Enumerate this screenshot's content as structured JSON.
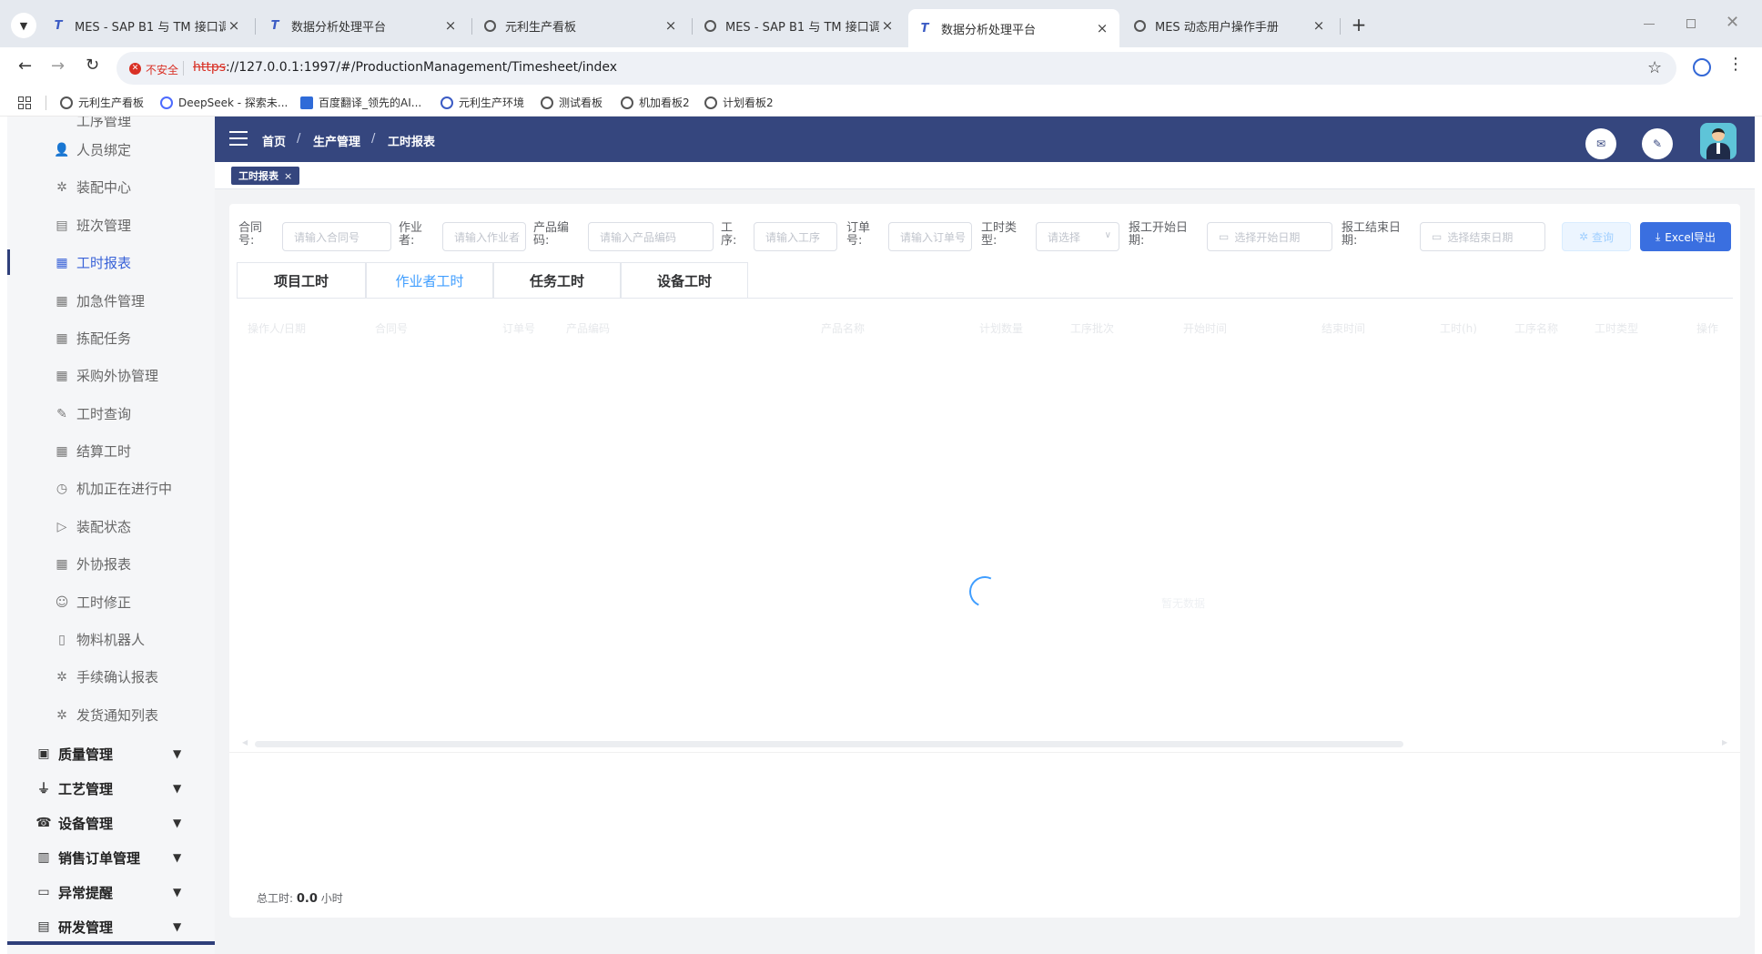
{
  "browser": {
    "tabs": [
      {
        "title": "MES - SAP B1 与 TM 接口调用",
        "icon": "tm-logo-icon",
        "active": false
      },
      {
        "title": "数据分析处理平台",
        "icon": "tm-logo-icon",
        "active": false
      },
      {
        "title": "元利生产看板",
        "icon": "globe-icon",
        "active": false
      },
      {
        "title": "MES - SAP B1 与 TM 接口调用",
        "icon": "globe-icon",
        "active": false
      },
      {
        "title": "数据分析处理平台",
        "icon": "tm-logo-icon",
        "active": true
      },
      {
        "title": "MES 动态用户操作手册",
        "icon": "globe-icon",
        "active": false
      }
    ],
    "close_glyph": "×",
    "new_tab_glyph": "+",
    "security_label": "不安全",
    "url_scheme": "https",
    "url_rest": "://127.0.0.1:1997/#/ProductionManagement/Timesheet/index",
    "bookmarks": [
      "元利生产看板",
      "DeepSeek - 探索未...",
      "百度翻译_领先的AI...",
      "元利生产环境",
      "测试看板",
      "机加看板2",
      "计划看板2"
    ]
  },
  "sidebar": {
    "partial_top_label": "工序管理",
    "items": [
      {
        "label": "人员绑定",
        "icon": "user-link-icon"
      },
      {
        "label": "装配中心",
        "icon": "gear-icon"
      },
      {
        "label": "班次管理",
        "icon": "calendar-icon"
      },
      {
        "label": "工时报表",
        "icon": "report-icon",
        "active": true
      },
      {
        "label": "加急件管理",
        "icon": "report-icon"
      },
      {
        "label": "拣配任务",
        "icon": "report-icon"
      },
      {
        "label": "采购外协管理",
        "icon": "report-icon"
      },
      {
        "label": "工时查询",
        "icon": "edit-icon"
      },
      {
        "label": "结算工时",
        "icon": "report-icon"
      },
      {
        "label": "机加正在进行中",
        "icon": "clock-icon"
      },
      {
        "label": "装配状态",
        "icon": "play-icon"
      },
      {
        "label": "外协报表",
        "icon": "report-icon"
      },
      {
        "label": "工时修正",
        "icon": "user-edit-icon"
      },
      {
        "label": "物料机器人",
        "icon": "document-icon"
      },
      {
        "label": "手续确认报表",
        "icon": "gear-icon"
      },
      {
        "label": "发货通知列表",
        "icon": "gear-icon"
      }
    ],
    "groups": [
      {
        "label": "质量管理",
        "icon": "quality-icon"
      },
      {
        "label": "工艺管理",
        "icon": "process-icon"
      },
      {
        "label": "设备管理",
        "icon": "device-icon"
      },
      {
        "label": "销售订单管理",
        "icon": "order-icon"
      },
      {
        "label": "异常提醒",
        "icon": "monitor-icon"
      },
      {
        "label": "研发管理",
        "icon": "rd-icon"
      }
    ],
    "caret_glyph": "▼"
  },
  "header": {
    "breadcrumb": [
      "首页",
      "生产管理",
      "工时报表"
    ],
    "separator": "/"
  },
  "tags": {
    "active_tag": "工时报表",
    "close_glyph": "×"
  },
  "filters": {
    "contract": {
      "label": "合同号:",
      "placeholder": "请输入合同号"
    },
    "operator": {
      "label": "作业者:",
      "placeholder": "请输入作业者"
    },
    "product_code": {
      "label": "产品编码:",
      "placeholder": "请输入产品编码"
    },
    "process": {
      "label": "工序:",
      "placeholder": "请输入工序"
    },
    "order": {
      "label": "订单号:",
      "placeholder": "请输入订单号"
    },
    "hour_type": {
      "label": "工时类型:",
      "placeholder": "请选择"
    },
    "start_date": {
      "label": "报工开始日期:",
      "placeholder": "选择开始日期"
    },
    "end_date": {
      "label": "报工结束日期:",
      "placeholder": "选择结束日期"
    },
    "query_button": "查询",
    "export_button": "Excel导出"
  },
  "report_tabs": [
    {
      "label": "项目工时",
      "active": false
    },
    {
      "label": "作业者工时",
      "active": true
    },
    {
      "label": "任务工时",
      "active": false
    },
    {
      "label": "设备工时",
      "active": false
    }
  ],
  "table": {
    "columns": [
      "操作人/日期",
      "合同号",
      "订单号",
      "产品编码",
      "产品名称",
      "计划数量",
      "工序批次",
      "开始时间",
      "结束时间",
      "工时(h)",
      "工序名称",
      "工时类型",
      "操作"
    ],
    "empty_text": "暂无数据"
  },
  "footer": {
    "total_label": "总工时:",
    "total_value": "0.0",
    "total_unit": "小时"
  },
  "colors": {
    "header_bg": "#35467e",
    "accent": "#409eff",
    "sidebar_active": "#3a63d8",
    "export_bg": "#3a6fe0"
  }
}
